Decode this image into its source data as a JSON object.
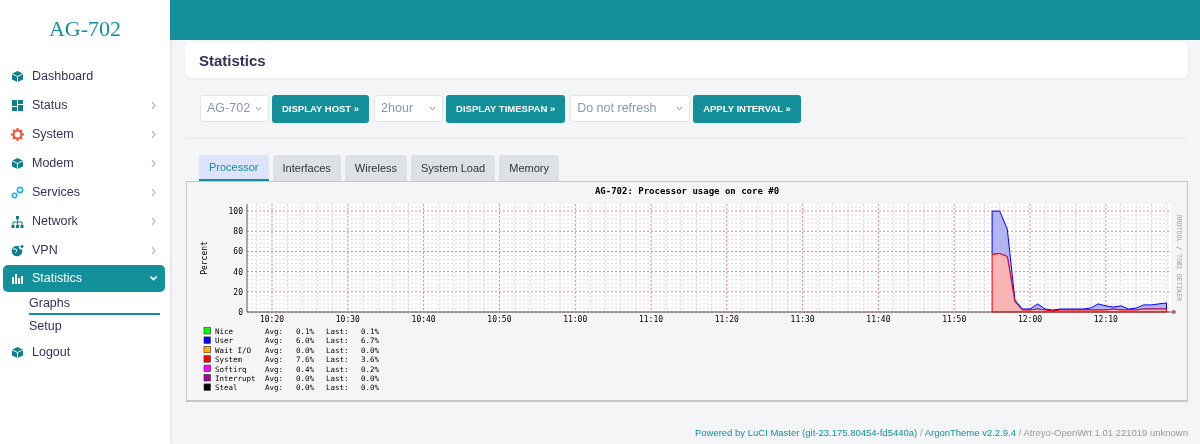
{
  "sidebar": {
    "logo": "AG-702",
    "items": [
      {
        "label": "Dashboard",
        "has_submenu": false,
        "expanded": false,
        "selected": false
      },
      {
        "label": "Status",
        "has_submenu": true,
        "expanded": false,
        "selected": false
      },
      {
        "label": "System",
        "has_submenu": true,
        "expanded": false,
        "selected": false
      },
      {
        "label": "Modem",
        "has_submenu": true,
        "expanded": false,
        "selected": false
      },
      {
        "label": "Services",
        "has_submenu": true,
        "expanded": false,
        "selected": false
      },
      {
        "label": "Network",
        "has_submenu": true,
        "expanded": false,
        "selected": false
      },
      {
        "label": "VPN",
        "has_submenu": true,
        "expanded": false,
        "selected": false
      },
      {
        "label": "Statistics",
        "has_submenu": true,
        "expanded": true,
        "selected": true,
        "children": [
          {
            "label": "Graphs",
            "selected": true
          },
          {
            "label": "Setup",
            "selected": false
          }
        ]
      },
      {
        "label": "Logout",
        "has_submenu": false,
        "expanded": false,
        "selected": false
      }
    ]
  },
  "page": {
    "title": "Statistics"
  },
  "controls": [
    {
      "kind": "select",
      "value": "AG-702"
    },
    {
      "kind": "button",
      "label": "DISPLAY HOST »"
    },
    {
      "kind": "select",
      "value": "2hour"
    },
    {
      "kind": "button",
      "label": "DISPLAY TIMESPAN »"
    },
    {
      "kind": "select",
      "value": "Do not refresh"
    },
    {
      "kind": "button",
      "label": "APPLY INTERVAL »"
    }
  ],
  "tabs": [
    {
      "label": "Processor",
      "selected": true
    },
    {
      "label": "Interfaces",
      "selected": false
    },
    {
      "label": "Wireless",
      "selected": false
    },
    {
      "label": "System Load",
      "selected": false
    },
    {
      "label": "Memory",
      "selected": false
    }
  ],
  "graph": {
    "side_text": "RRDTOOL / TOBI OETIKER",
    "chart_data": {
      "type": "area",
      "title": "AG-702: Processor usage on core #0",
      "ylabel": "Percent",
      "stacked": true,
      "categories": [
        null,
        null,
        null,
        "10:20",
        null,
        null,
        null,
        null,
        null,
        null,
        null,
        null,
        null,
        "10:30",
        null,
        null,
        null,
        null,
        null,
        null,
        null,
        null,
        null,
        "10:40",
        null,
        null,
        null,
        null,
        null,
        null,
        null,
        null,
        null,
        "10:50",
        null,
        null,
        null,
        null,
        null,
        null,
        null,
        null,
        null,
        "11:00",
        null,
        null,
        null,
        null,
        null,
        null,
        null,
        null,
        null,
        "11:10",
        null,
        null,
        null,
        null,
        null,
        null,
        null,
        null,
        null,
        "11:20",
        null,
        null,
        null,
        null,
        null,
        null,
        null,
        null,
        null,
        "11:30",
        null,
        null,
        null,
        null,
        null,
        null,
        null,
        null,
        null,
        "11:40",
        null,
        null,
        null,
        null,
        null,
        null,
        null,
        null,
        null,
        "11:50",
        null,
        null,
        null,
        null,
        null,
        null,
        null,
        null,
        null,
        "12:00",
        null,
        null,
        null,
        null,
        null,
        null,
        null,
        null,
        null,
        "12:10",
        null,
        null,
        null,
        null,
        null,
        null,
        null,
        null
      ],
      "series": [
        {
          "color": "#0000ff",
          "values": [
            null,
            null,
            null,
            null,
            null,
            null,
            null,
            null,
            null,
            null,
            null,
            null,
            null,
            null,
            null,
            null,
            null,
            null,
            null,
            null,
            null,
            null,
            null,
            null,
            null,
            null,
            null,
            null,
            null,
            null,
            null,
            null,
            null,
            null,
            null,
            null,
            null,
            null,
            null,
            null,
            null,
            null,
            null,
            null,
            null,
            null,
            null,
            null,
            null,
            null,
            null,
            null,
            null,
            null,
            null,
            null,
            null,
            null,
            null,
            null,
            null,
            null,
            null,
            null,
            null,
            null,
            null,
            null,
            null,
            null,
            null,
            null,
            null,
            null,
            null,
            null,
            null,
            null,
            null,
            null,
            null,
            null,
            null,
            null,
            null,
            null,
            null,
            null,
            null,
            null,
            null,
            null,
            null,
            null,
            null,
            null,
            null,
            null,
            43,
            42,
            27,
            2,
            1,
            1,
            5,
            1,
            1,
            1,
            1,
            1,
            1,
            2,
            6,
            4,
            2,
            4,
            1,
            2,
            4,
            4,
            5,
            6
          ]
        },
        {
          "color": "#ff0000",
          "values": [
            null,
            null,
            null,
            null,
            null,
            null,
            null,
            null,
            null,
            null,
            null,
            null,
            null,
            null,
            null,
            null,
            null,
            null,
            null,
            null,
            null,
            null,
            null,
            null,
            null,
            null,
            null,
            null,
            null,
            null,
            null,
            null,
            null,
            null,
            null,
            null,
            null,
            null,
            null,
            null,
            null,
            null,
            null,
            null,
            null,
            null,
            null,
            null,
            null,
            null,
            null,
            null,
            null,
            null,
            null,
            null,
            null,
            null,
            null,
            null,
            null,
            null,
            null,
            null,
            null,
            null,
            null,
            null,
            null,
            null,
            null,
            null,
            null,
            null,
            null,
            null,
            null,
            null,
            null,
            null,
            null,
            null,
            null,
            null,
            null,
            null,
            null,
            null,
            null,
            null,
            null,
            null,
            null,
            null,
            null,
            null,
            null,
            null,
            57,
            58,
            55,
            10,
            2,
            2,
            3,
            2,
            1,
            2,
            2,
            2,
            2,
            2,
            2,
            2,
            3,
            2,
            2,
            2,
            3,
            3,
            3,
            3
          ]
        }
      ],
      "ylim": [
        0,
        107
      ],
      "grid": true,
      "yticks": [
        0,
        20,
        40,
        60,
        80,
        100
      ]
    },
    "legend": [
      {
        "name": "Nice",
        "color": "#00ff00",
        "avg_label": "Avg:",
        "avg": "0.1%",
        "last_label": "Last:",
        "last": "0.1%"
      },
      {
        "name": "User",
        "color": "#0000ff",
        "avg_label": "Avg:",
        "avg": "6.0%",
        "last_label": "Last:",
        "last": "6.7%"
      },
      {
        "name": "Wait I/O",
        "color": "#ffb000",
        "avg_label": "Avg:",
        "avg": "0.0%",
        "last_label": "Last:",
        "last": "0.0%"
      },
      {
        "name": "System",
        "color": "#ff0000",
        "avg_label": "Avg:",
        "avg": "7.6%",
        "last_label": "Last:",
        "last": "3.6%"
      },
      {
        "name": "Softirq",
        "color": "#ff00ff",
        "avg_label": "Avg:",
        "avg": "0.4%",
        "last_label": "Last:",
        "last": "0.2%"
      },
      {
        "name": "Interrupt",
        "color": "#a000a0",
        "avg_label": "Avg:",
        "avg": "0.0%",
        "last_label": "Last:",
        "last": "0.0%"
      },
      {
        "name": "Steal",
        "color": "#000000",
        "avg_label": "Avg:",
        "avg": "0.0%",
        "last_label": "Last:",
        "last": "0.0%"
      }
    ]
  },
  "footer": [
    {
      "kind": "link",
      "text": "Powered by LuCI Master (git-23.175.80454-fd5440a)"
    },
    {
      "kind": "text",
      "text": "/"
    },
    {
      "kind": "link",
      "text": "ArgonTheme v2.2.9.4"
    },
    {
      "kind": "text",
      "text": "/ Atreyo-OpenWrt 1.01 221019 unknown"
    }
  ]
}
